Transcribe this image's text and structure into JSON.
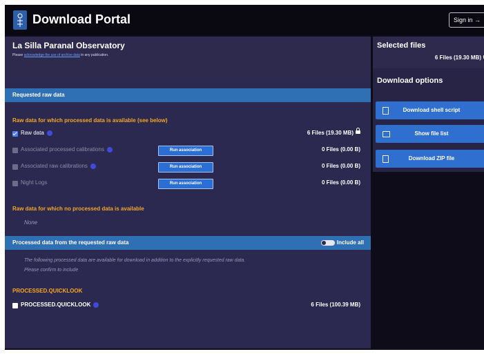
{
  "header": {
    "app_title": "Download Portal",
    "sign_in_label": "Sign in",
    "logo_icon": "eso-logo-icon"
  },
  "org": {
    "title": "La Silla Paranal Observatory",
    "ack_prefix": "Please",
    "ack_link": "acknowledge the use of archive data",
    "ack_suffix": "in any publication."
  },
  "requested": {
    "bar_title": "Requested raw data",
    "processed_available_heading": "Raw data for which processed data is available (see below)",
    "rows": [
      {
        "label": "Raw data",
        "checked": true,
        "run": false,
        "files": "6 Files (19.30 MB)",
        "locked": true
      },
      {
        "label": "Associated processed calibrations",
        "checked": false,
        "run": true,
        "run_label": "Run association",
        "files": "0 Files (0.00 B)",
        "locked": false
      },
      {
        "label": "Associated raw calibrations",
        "checked": false,
        "run": true,
        "run_label": "Run association",
        "files": "0 Files (0.00 B)",
        "locked": false
      },
      {
        "label": "Night Logs",
        "checked": false,
        "run": true,
        "run_label": "Run association",
        "files": "0 Files (0.00 B)",
        "locked": false
      }
    ],
    "no_processed_heading": "Raw data for which no processed data is available",
    "none_text": "None"
  },
  "processed": {
    "bar_title": "Processed data from the requested raw data",
    "include_all_label": "Include all",
    "include_all_on": false,
    "description_line1": "The following processed data are available for download in addition to the explicitly requested raw data.",
    "description_line2": "Please confirm to include",
    "category_heading": "PROCESSED.QUICKLOOK",
    "item_label": "PROCESSED.QUICKLOOK",
    "item_files": "6 Files (100.39 MB)"
  },
  "sidebar": {
    "selected_title": "Selected files",
    "selected_count": "6 Files (19.30 MB)",
    "options_title": "Download options",
    "buttons": [
      {
        "label": "Download shell script",
        "icon": "script-file-icon"
      },
      {
        "label": "Show file list",
        "icon": "list-icon"
      },
      {
        "label": "Download ZIP file",
        "icon": "zip-file-icon"
      }
    ]
  },
  "colors": {
    "accent_blue": "#2f6fb3",
    "heading_orange": "#f5a623",
    "panel_bg": "#2c2950"
  }
}
